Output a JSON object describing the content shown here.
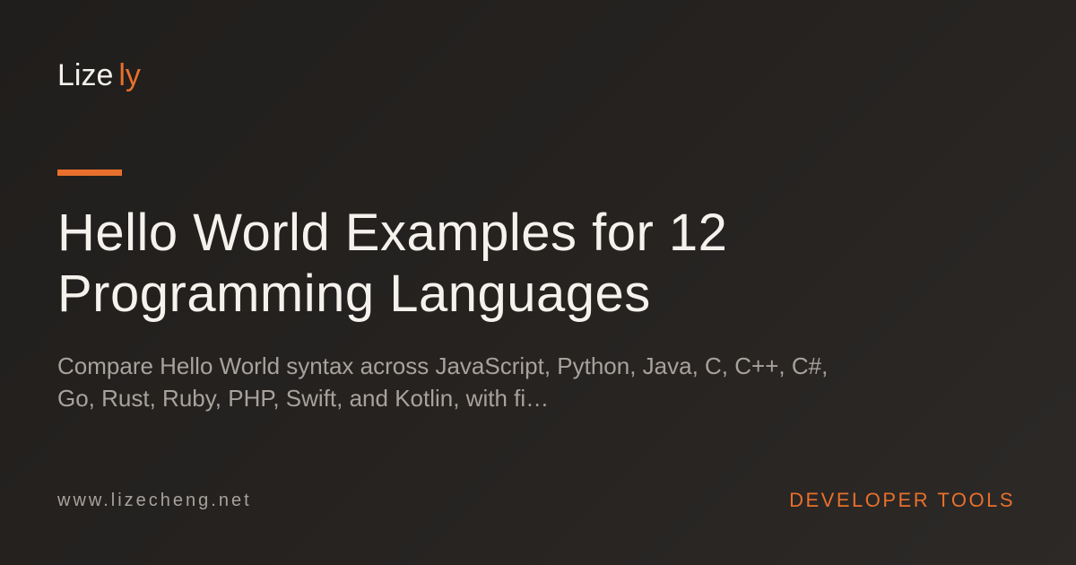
{
  "brand": {
    "logo_part_a": "Lize",
    "logo_part_b": "ly",
    "accent_color": "#e8702c"
  },
  "article": {
    "title_line_1": "Hello World Examples for 12",
    "title_line_2": "Programming Languages",
    "description_line_1": "Compare Hello World syntax across JavaScript, Python, Java, C, C++, C#,",
    "description_line_2": "Go, Rust, Ruby, PHP, Swift, and Kotlin, with fi…"
  },
  "footer": {
    "url": "www.lizecheng.net",
    "category": "DEVELOPER TOOLS"
  }
}
